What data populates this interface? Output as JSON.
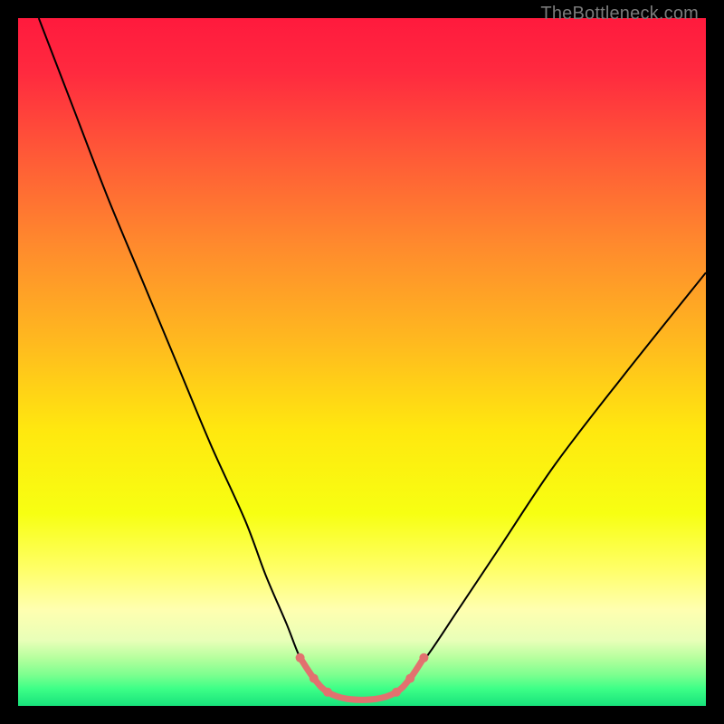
{
  "watermark": "TheBottleneck.com",
  "chart_data": {
    "type": "line",
    "title": "",
    "xlabel": "",
    "ylabel": "",
    "xlim": [
      0,
      100
    ],
    "ylim": [
      0,
      100
    ],
    "grid": false,
    "legend": false,
    "background_gradient": {
      "stops": [
        {
          "offset": 0.0,
          "color": "#ff1a3d"
        },
        {
          "offset": 0.08,
          "color": "#ff2a3f"
        },
        {
          "offset": 0.2,
          "color": "#ff5a37"
        },
        {
          "offset": 0.33,
          "color": "#ff8a2d"
        },
        {
          "offset": 0.47,
          "color": "#ffb91f"
        },
        {
          "offset": 0.6,
          "color": "#ffe80f"
        },
        {
          "offset": 0.72,
          "color": "#f7ff12"
        },
        {
          "offset": 0.8,
          "color": "#ffff66"
        },
        {
          "offset": 0.86,
          "color": "#ffffb0"
        },
        {
          "offset": 0.905,
          "color": "#e8ffb8"
        },
        {
          "offset": 0.93,
          "color": "#b6ff9e"
        },
        {
          "offset": 0.955,
          "color": "#7cff8f"
        },
        {
          "offset": 0.975,
          "color": "#3dff87"
        },
        {
          "offset": 1.0,
          "color": "#17e27b"
        }
      ]
    },
    "series": [
      {
        "name": "curve",
        "color": "#000000",
        "width": 2,
        "x": [
          3,
          8,
          13,
          18,
          23,
          28,
          33,
          36,
          39,
          41,
          43,
          45,
          48,
          52,
          55,
          57,
          60,
          64,
          70,
          78,
          88,
          100
        ],
        "y": [
          100,
          87,
          74,
          62,
          50,
          38,
          27,
          19,
          12,
          7,
          4,
          2,
          1,
          1,
          2,
          4,
          8,
          14,
          23,
          35,
          48,
          63
        ]
      },
      {
        "name": "trough-highlight",
        "color": "#e2716f",
        "width": 7,
        "x": [
          41,
          43,
          45,
          48,
          52,
          55,
          57,
          59
        ],
        "y": [
          7,
          4,
          2,
          1,
          1,
          2,
          4,
          7
        ]
      }
    ],
    "highlight_points": {
      "color": "#e2716f",
      "radius": 5,
      "points": [
        {
          "x": 41,
          "y": 7
        },
        {
          "x": 43,
          "y": 4
        },
        {
          "x": 45,
          "y": 2
        },
        {
          "x": 55,
          "y": 2
        },
        {
          "x": 57,
          "y": 4
        },
        {
          "x": 59,
          "y": 7
        }
      ]
    }
  }
}
